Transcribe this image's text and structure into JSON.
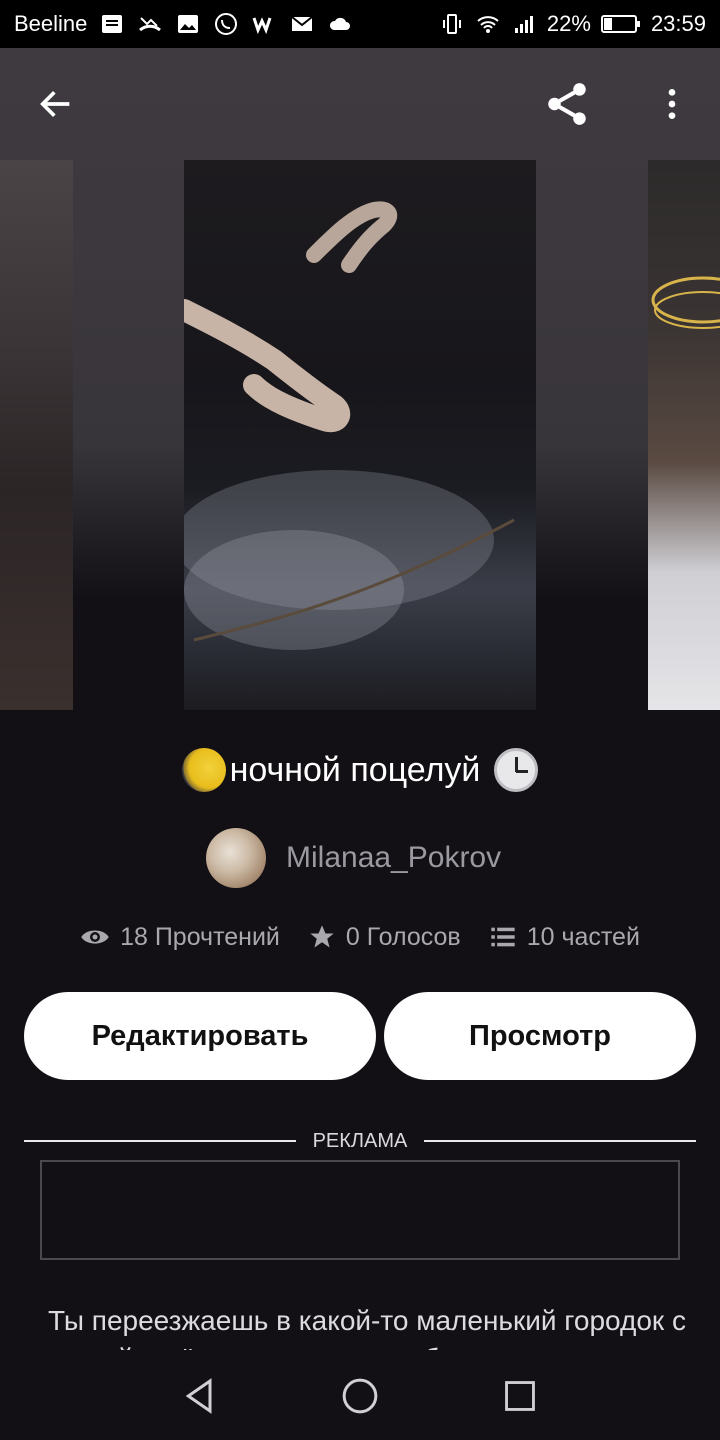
{
  "status_bar": {
    "carrier": "Beeline",
    "battery": "22%",
    "time": "23:59"
  },
  "story": {
    "title": "ночной поцелуй",
    "author": "Milanaa_Pokrov",
    "reads": "18 Прочтений",
    "votes": "0 Голосов",
    "parts": "10 частей",
    "description": "Ты переезжаешь в какой-то маленький городок с мамой и её мужем, ты не любишь"
  },
  "actions": {
    "edit_label": "Редактировать",
    "view_label": "Просмотр"
  },
  "ad": {
    "label": "РЕКЛАМА"
  },
  "icons": {
    "back": "arrow-left-icon",
    "share": "share-icon",
    "more": "more-vert-icon",
    "reads": "eye-icon",
    "votes": "star-icon",
    "parts": "list-icon"
  }
}
